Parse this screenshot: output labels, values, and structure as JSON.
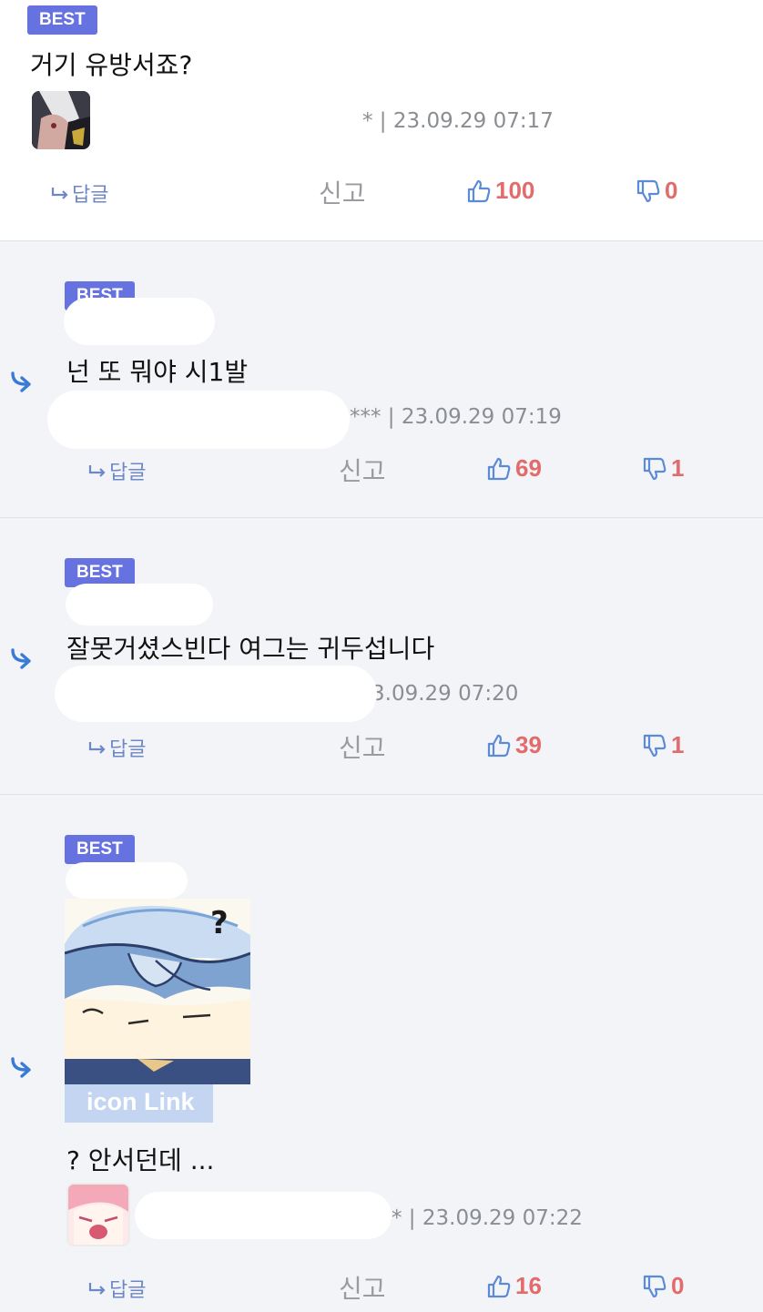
{
  "best_label": "BEST",
  "reply_label": "답글",
  "report_label": "신고",
  "comments": [
    {
      "text": "거기 유방서죠?",
      "meta": "* | 23.09.29 07:17",
      "likes": "100",
      "dislikes": "0"
    },
    {
      "text": "넌 또 뭐야 시1발",
      "meta": "*** | 23.09.29 07:19",
      "likes": "69",
      "dislikes": "1"
    },
    {
      "text": "잘못거셨스빈다 여그는 귀두섭니다",
      "meta": "3.09.29 07:20",
      "likes": "39",
      "dislikes": "1"
    },
    {
      "text": "? 안서던데 ...",
      "meta": "* | 23.09.29 07:22",
      "likes": "16",
      "dislikes": "0",
      "image_caption": "icon Link"
    }
  ],
  "colors": {
    "best_badge": "#6572df",
    "vote_count": "#e26b6b",
    "icon_blue": "#5a8ad8",
    "reply_bg": "#f3f4f7"
  },
  "icons": [
    "reply-arrow-icon",
    "thumbs-up-icon",
    "thumbs-down-icon",
    "nested-reply-arrow-icon"
  ]
}
